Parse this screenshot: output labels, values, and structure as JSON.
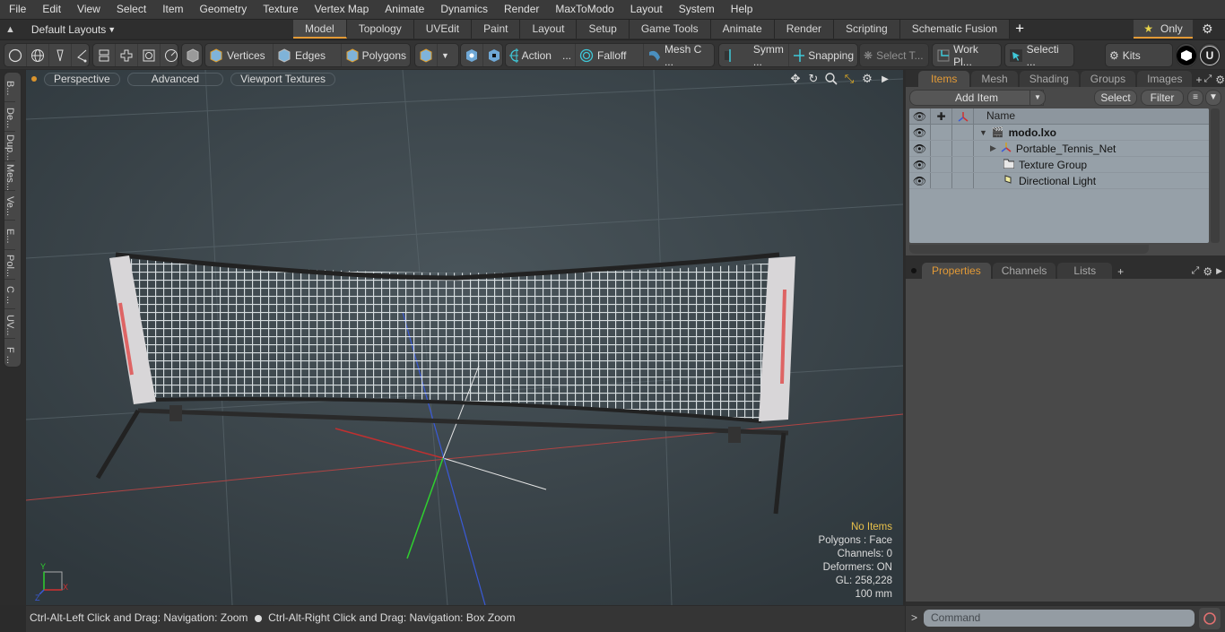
{
  "menu": [
    "File",
    "Edit",
    "View",
    "Select",
    "Item",
    "Geometry",
    "Texture",
    "Vertex Map",
    "Animate",
    "Dynamics",
    "Render",
    "MaxToModo",
    "Layout",
    "System",
    "Help"
  ],
  "layout_selector": "Default Layouts",
  "layout_tabs": [
    {
      "label": "Model",
      "active": true
    },
    {
      "label": "Topology"
    },
    {
      "label": "UVEdit"
    },
    {
      "label": "Paint"
    },
    {
      "label": "Layout"
    },
    {
      "label": "Setup"
    },
    {
      "label": "Game Tools"
    },
    {
      "label": "Animate"
    },
    {
      "label": "Render"
    },
    {
      "label": "Scripting"
    },
    {
      "label": "Schematic Fusion"
    }
  ],
  "only_label": "Only",
  "toolbar": {
    "vertices": "Vertices",
    "edges": "Edges",
    "polygons": "Polygons",
    "action": "Action",
    "falloff": "Falloff",
    "mesh": "Mesh C ...",
    "symm": "Symm ...",
    "snapping": "Snapping",
    "select_t": "Select T...",
    "work_plane": "Work Pl...",
    "selecti": "Selecti ...",
    "kits": "Kits"
  },
  "left_tabs": [
    "B...",
    "De...",
    "Dup...",
    "Mes...",
    "Ve...",
    "E...",
    "Pol...",
    "C ...",
    "UV...",
    "F ..."
  ],
  "viewport": {
    "perspective": "Perspective",
    "advanced": "Advanced",
    "textures": "Viewport Textures",
    "info": {
      "no_items": "No Items",
      "polygons": "Polygons : Face",
      "channels": "Channels: 0",
      "deformers": "Deformers: ON",
      "gl": "GL: 258,228",
      "units": "100 mm"
    },
    "axis_labels": {
      "x": "X",
      "y": "Y",
      "z": "Z"
    }
  },
  "status": {
    "left": "Ctrl-Alt-Left Click and Drag: Navigation: Zoom",
    "right": "Ctrl-Alt-Right Click and Drag: Navigation: Box Zoom"
  },
  "items_panel": {
    "tabs": [
      {
        "label": "Items",
        "active": true
      },
      {
        "label": "Mesh ..."
      },
      {
        "label": "Shading"
      },
      {
        "label": "Groups"
      },
      {
        "label": "Images"
      }
    ],
    "add_item": "Add Item",
    "select": "Select",
    "filter": "Filter",
    "name_header": "Name",
    "tree": [
      {
        "label": "modo.lxo",
        "icon": "scene-icon",
        "bold": true
      },
      {
        "label": "Portable_Tennis_Net",
        "icon": "mesh-locator-icon"
      },
      {
        "label": "Texture Group",
        "icon": "folder-icon"
      },
      {
        "label": "Directional Light",
        "icon": "light-icon"
      }
    ]
  },
  "properties_panel": {
    "tabs": [
      {
        "label": "Properties",
        "active": true
      },
      {
        "label": "Channels"
      },
      {
        "label": "Lists"
      }
    ]
  },
  "command": {
    "placeholder": "Command"
  },
  "colors": {
    "accent": "#e39a36",
    "viewport_bg": "#39444a",
    "tree_bg": "#96a0a8"
  }
}
